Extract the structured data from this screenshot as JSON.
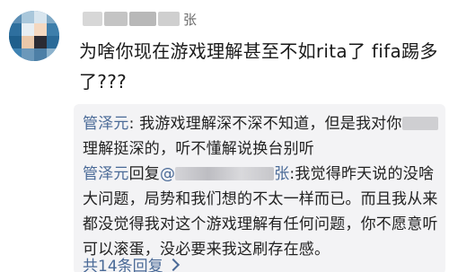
{
  "comment": {
    "username_suffix": "张",
    "text": "为啥你现在游戏理解甚至不如rita了 fifa踢多了???"
  },
  "replies": [
    {
      "author": "管泽元",
      "separator": ": ",
      "text_before_redaction": "我游戏理解深不深不知道，但是我对你",
      "text_after_redaction": "理解挺深的，听不懂解说换台别听"
    },
    {
      "author": "管泽元",
      "reply_word": "回复",
      "at_sign": "@",
      "target_suffix": "张",
      "separator": ":",
      "text": "我觉得昨天说的没啥大问题，局势和我们想的不太一样而已。而且我从来都没觉得我对这个游戏理解有任何问题，你不愿意听可以滚蛋，没必要来我这刷存在感。"
    }
  ],
  "more_replies_label": "共14条回复",
  "icons": {
    "more_replies": "chevron-right-icon"
  },
  "colors": {
    "author": "#4a6a97",
    "reply_background": "#f3f3f5",
    "text": "#1a1a1a"
  }
}
